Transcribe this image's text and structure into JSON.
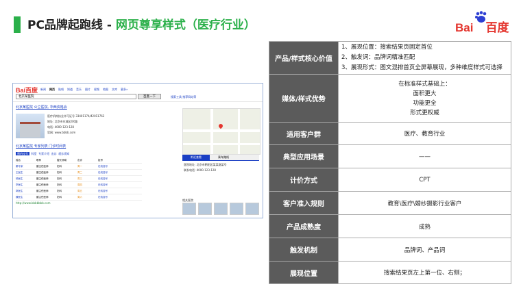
{
  "slide": {
    "title_prefix": "PC品牌起跑线 - ",
    "title_highlight": "网页尊享样式（医疗行业）",
    "logo_text": "Bai",
    "logo_cn": "百度",
    "logo_paw": "du"
  },
  "colors": {
    "accent_green": "#2bb04a",
    "label_bg": "#5b5b5b",
    "baidu_red": "#e4362f",
    "link_blue": "#1a3fc4"
  },
  "screenshot": {
    "logo": "Bai百度",
    "nav": [
      "新闻",
      "网页",
      "贴吧",
      "知道",
      "音乐",
      "图片",
      "视频",
      "地图",
      "文库",
      "更多»"
    ],
    "search_value": "北京某医院",
    "search_button": "百度一下",
    "top_right": "搜索工具 推荐网站等",
    "result_title": "北京某医院 公立医院, 华西资格会",
    "result_lines": [
      "医疗机构执业许可证号 33401174/42011763",
      "地址: 北京市东城区XX路",
      "电话: 4000-123-128",
      "官网: www.bbbb.com"
    ],
    "sub_title": "北京某医院  专家列表 门诊时间表",
    "sub_tabs": [
      "预约挂号",
      "科室",
      "专家介绍",
      "出诊",
      "就诊须知"
    ],
    "doctor_rows": [
      [
        "姓名",
        "职称",
        "擅长领域",
        "出诊",
        "挂号"
      ],
      [
        "秦专家",
        "副主任医师",
        "妇科",
        "周一",
        "在线挂号"
      ],
      [
        "王医生",
        "副主任医师",
        "妇科",
        "周二",
        "在线挂号"
      ],
      [
        "杨医生",
        "副主任医师",
        "妇科",
        "周三",
        "在线挂号"
      ],
      [
        "李医生",
        "副主任医师",
        "妇科",
        "周四",
        "在线挂号"
      ],
      [
        "郭医生",
        "副主任医师",
        "妇科",
        "周五",
        "在线挂号"
      ],
      [
        "魏医生",
        "副主任医师",
        "妇科",
        "周六",
        "在线挂号"
      ]
    ],
    "result_url": "http://www.bbbbbbb.com",
    "right_tabs": [
      "附近查看",
      "乘车路线"
    ],
    "right_lines": [
      "医院地址: 北京市朝阳区某某路某号",
      "联系电话: 4000-123-128"
    ],
    "related_label": "相关医院"
  },
  "rows": [
    {
      "label": "产品/样式核心价值",
      "lines": [
        "1、展现位置：搜索结果页固定首位",
        "2、触发词：品牌词精准匹配",
        "3、展现形式：图文混排首页全屏幕展现，多种维度样式可选择"
      ],
      "align": "left"
    },
    {
      "label": "媒体/样式优势",
      "lines": [
        "在标准样式基础上：",
        "面积更大",
        "功能更全",
        "形式更权威"
      ],
      "align": "center"
    },
    {
      "label": "适用客户群",
      "lines": [
        "医疗、教育行业"
      ],
      "align": "center"
    },
    {
      "label": "典型应用场景",
      "lines": [
        "——"
      ],
      "align": "center"
    },
    {
      "label": "计价方式",
      "lines": [
        "CPT"
      ],
      "align": "center"
    },
    {
      "label": "客户准入规则",
      "lines": [
        "教育\\医疗\\婚纱摄影行业客户"
      ],
      "align": "center"
    },
    {
      "label": "产品成熟度",
      "lines": [
        "成熟"
      ],
      "align": "center"
    },
    {
      "label": "触发机制",
      "lines": [
        "品牌词、产品词"
      ],
      "align": "center"
    },
    {
      "label": "展现位置",
      "lines": [
        "搜索结果页左上第一位、右侧；"
      ],
      "align": "center"
    }
  ]
}
